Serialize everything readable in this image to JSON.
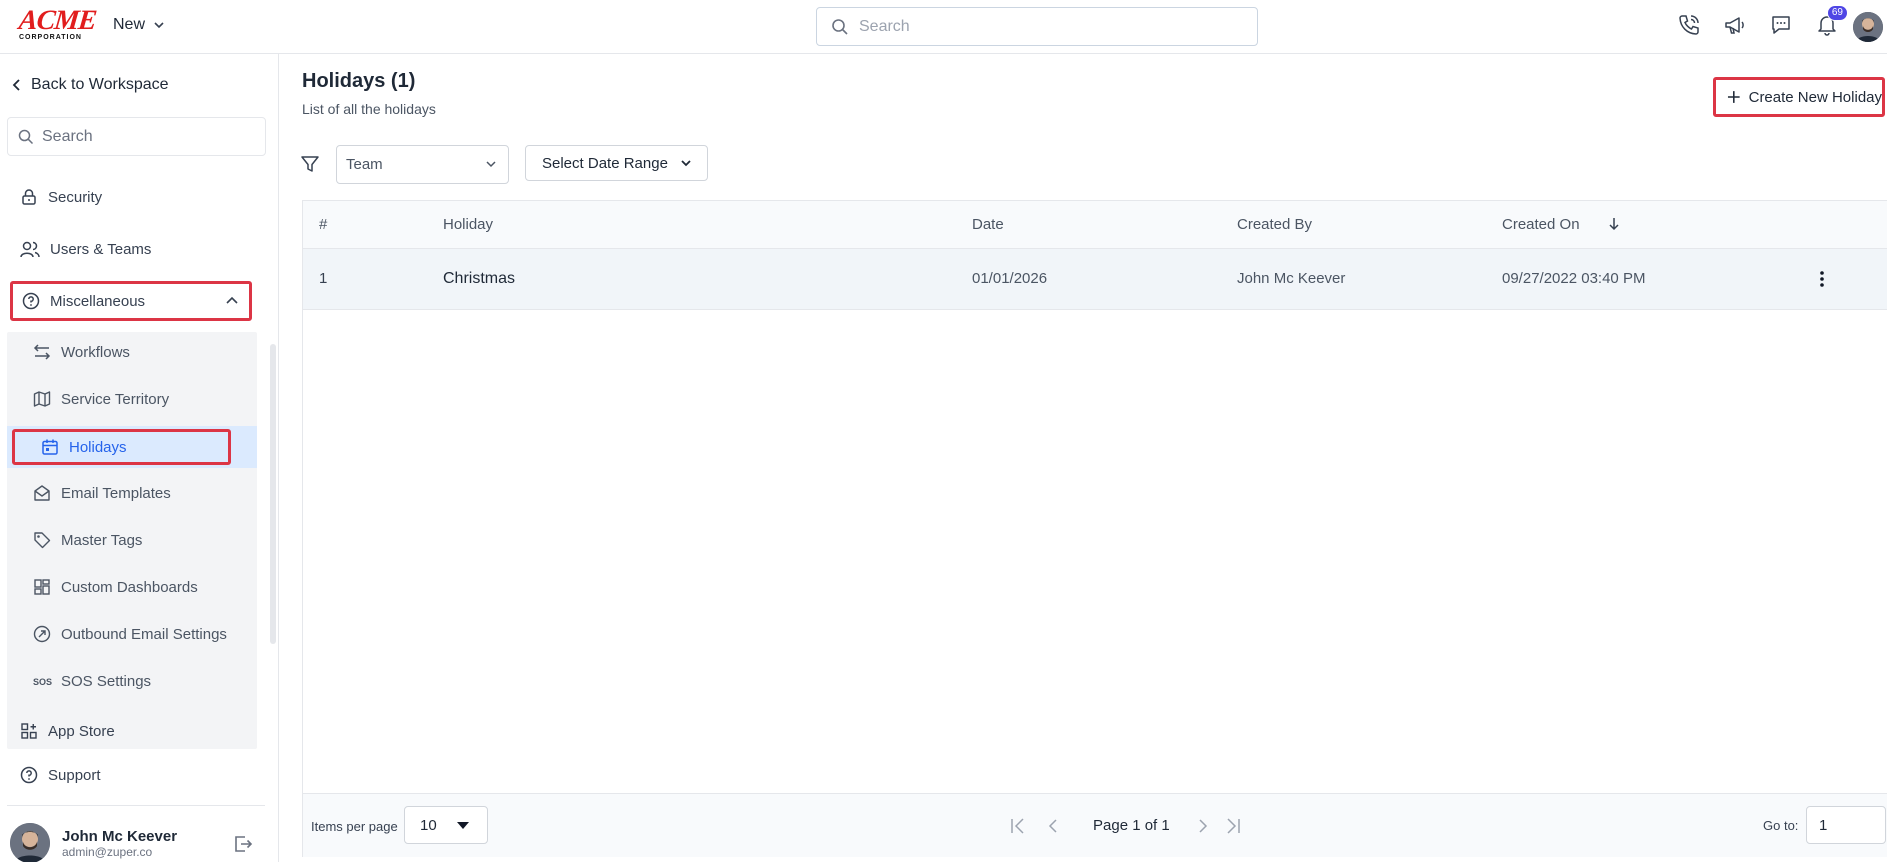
{
  "topbar": {
    "logo_text": "ACME",
    "logo_sub": "CORPORATION",
    "new_label": "New",
    "search_placeholder": "Search",
    "notification_count": "69",
    "icons": [
      "phone-icon",
      "megaphone-icon",
      "chat-icon",
      "bell-icon"
    ]
  },
  "sidebar": {
    "back_label": "Back to Workspace",
    "search_placeholder": "Search",
    "items": [
      {
        "label": "Security",
        "icon": "lock-icon"
      },
      {
        "label": "Users & Teams",
        "icon": "users-icon"
      },
      {
        "label": "Miscellaneous",
        "icon": "help-circle-icon",
        "expanded": true
      }
    ],
    "sub_items": [
      {
        "label": "Workflows",
        "icon": "workflow-icon"
      },
      {
        "label": "Service Territory",
        "icon": "map-icon"
      },
      {
        "label": "Holidays",
        "icon": "calendar-icon",
        "active": true
      },
      {
        "label": "Email Templates",
        "icon": "mail-open-icon"
      },
      {
        "label": "Master Tags",
        "icon": "tag-icon"
      },
      {
        "label": "Custom Dashboards",
        "icon": "dashboard-icon"
      },
      {
        "label": "Outbound Email Settings",
        "icon": "outbound-icon"
      },
      {
        "label": "SOS Settings",
        "icon": "sos-icon",
        "icon_text": "SOS"
      }
    ],
    "bottom_items": [
      {
        "label": "App Store",
        "icon": "apps-icon"
      },
      {
        "label": "Support",
        "icon": "help-circle-icon"
      }
    ],
    "user": {
      "name": "John Mc Keever",
      "email": "admin@zuper.co"
    }
  },
  "main": {
    "title": "Holidays (1)",
    "subtitle": "List of all the holidays",
    "create_label": "Create New Holiday",
    "team_placeholder": "Team",
    "date_range_label": "Select Date Range",
    "table": {
      "columns": [
        "#",
        "Holiday",
        "Date",
        "Created By",
        "Created On"
      ],
      "rows": [
        {
          "index": "1",
          "holiday": "Christmas",
          "date": "01/01/2026",
          "created_by": "John Mc Keever",
          "created_on": "09/27/2022 03:40 PM"
        }
      ]
    },
    "pager": {
      "items_per_page_label": "Items per page",
      "items_per_page": "10",
      "page_info": "Page 1 of 1",
      "goto_label": "Go to:",
      "goto_value": "1"
    }
  },
  "colors": {
    "highlight": "#dc3545",
    "accent": "#2563eb",
    "badge": "#4f46e5"
  }
}
